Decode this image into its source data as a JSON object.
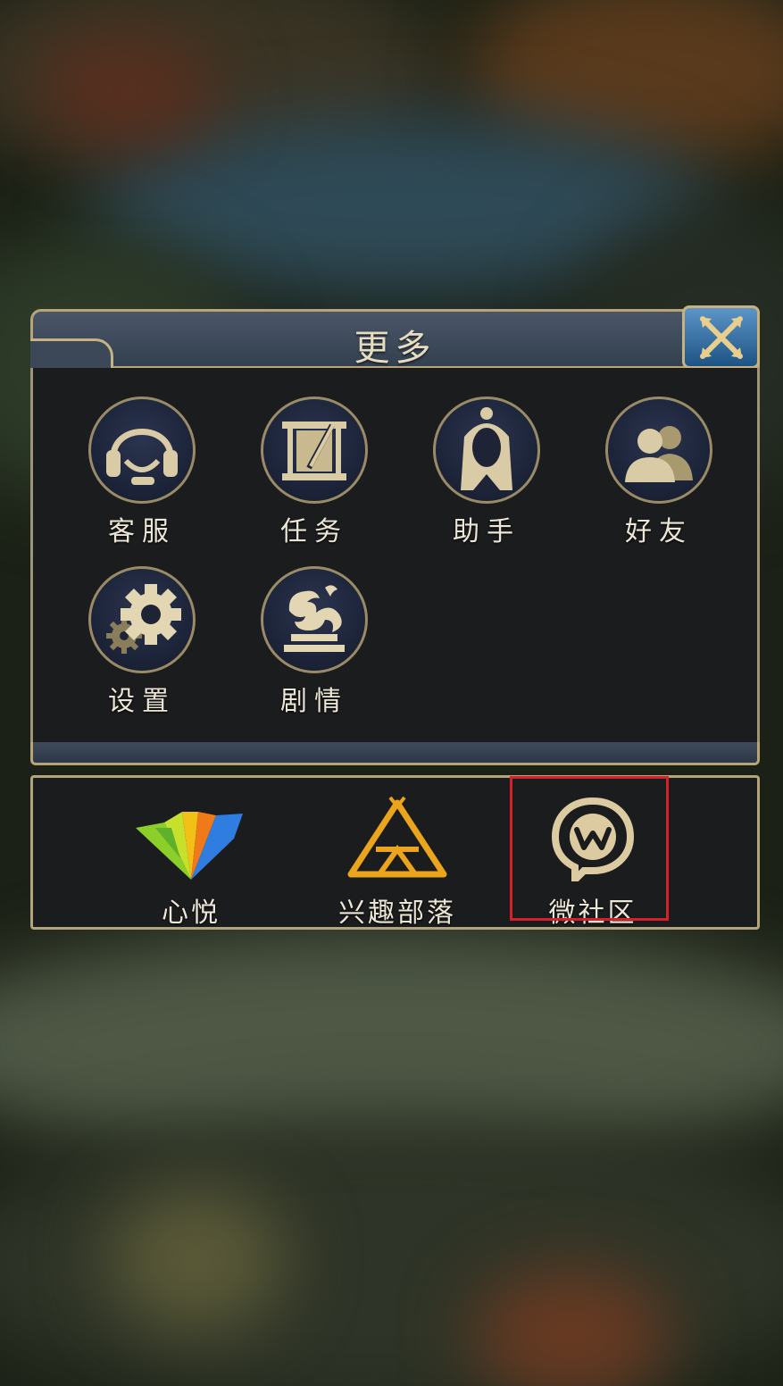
{
  "dialog": {
    "title": "更多",
    "close_label": "×"
  },
  "grid": [
    {
      "label": "客服",
      "icon": "headset-icon"
    },
    {
      "label": "任务",
      "icon": "scroll-quest-icon"
    },
    {
      "label": "助手",
      "icon": "helper-avatar-icon"
    },
    {
      "label": "好友",
      "icon": "friends-icon"
    },
    {
      "label": "设置",
      "icon": "gear-icon"
    },
    {
      "label": "剧情",
      "icon": "dragon-icon"
    }
  ],
  "social": [
    {
      "label": "心悦",
      "icon": "vip-icon"
    },
    {
      "label": "兴趣部落",
      "icon": "tribe-tent-icon"
    },
    {
      "label": "微社区",
      "icon": "wechat-community-icon",
      "highlighted": true
    }
  ],
  "colors": {
    "gold": "#d6c08a",
    "highlight": "#d8202a",
    "panel_bg": "#1b1c1e",
    "header_bg": "#3a4658"
  }
}
